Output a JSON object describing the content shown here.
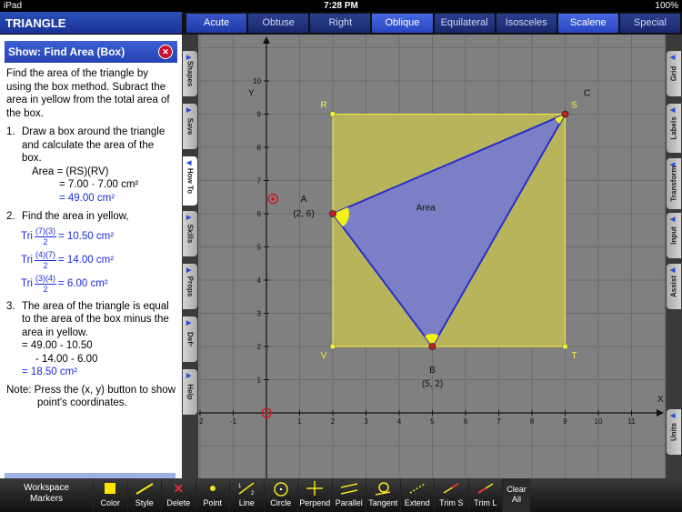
{
  "status": {
    "carrier": "iPad",
    "time": "7:28 PM",
    "battery": "100%"
  },
  "app_title": "TRIANGLE",
  "tabs": [
    {
      "label": "Acute",
      "state": "normal"
    },
    {
      "label": "Obtuse",
      "state": "dim"
    },
    {
      "label": "Right",
      "state": "dim"
    },
    {
      "label": "Oblique",
      "state": "selected"
    },
    {
      "label": "Equilateral",
      "state": "dim"
    },
    {
      "label": "Isosceles",
      "state": "dim"
    },
    {
      "label": "Scalene",
      "state": "selected"
    },
    {
      "label": "Special",
      "state": "dim"
    }
  ],
  "panel": {
    "header": "Show: Find Area (Box)",
    "close_icon": "x-circle-icon",
    "intro": "Find the area of the triangle by using the box method. Subract the area in yellow from the total area of the box.",
    "step1_num": "1.",
    "step1_text": "Draw a box around the triangle and calculate the area of the box.",
    "step1_eq1": "Area = (RS)(RV)",
    "step1_eq2": "= 7.00 · 7.00 cm²",
    "step1_eq3": "= 49.00 cm²",
    "step2_num": "2.",
    "step2_text": "Find the area in yellow,",
    "tri_label": "Tri",
    "tri1": {
      "num": "(7)(3)",
      "den": "2",
      "result": "= 10.50 cm²"
    },
    "tri2": {
      "num": "(4)(7)",
      "den": "2",
      "result": "= 14.00 cm²"
    },
    "tri3": {
      "num": "(3)(4)",
      "den": "2",
      "result": "= 6.00 cm²"
    },
    "step3_num": "3.",
    "step3_text": "The area of the triangle is equal to the area of the box minus the area in yellow.",
    "step3_eq1": "= 49.00 - 10.50",
    "step3_eq2": "- 14.00 - 6.00",
    "step3_eq3": "= 18.50 cm²",
    "note": "Note:  Press the (x, y) button to show point's coordinates."
  },
  "left_tabs": [
    "Shapes",
    "Save",
    "How To",
    "Skills",
    "Props",
    "Defⁿ",
    "Help"
  ],
  "right_tabs": [
    "Grid",
    "Labels",
    "Transform",
    "Input",
    "Assist",
    "Units"
  ],
  "graph": {
    "x_axis_label": "X",
    "y_axis_label": "Y",
    "x_ticks": [
      "-2",
      "-1",
      "1",
      "2",
      "3",
      "4",
      "5",
      "6",
      "7",
      "8",
      "9",
      "10",
      "11"
    ],
    "y_ticks": [
      "1",
      "2",
      "3",
      "4",
      "5",
      "6",
      "7",
      "8",
      "9",
      "10"
    ],
    "triangle_name": "C",
    "area_label": "Area",
    "points": [
      {
        "name": "A",
        "coords": "(2, 6)",
        "x": 2,
        "y": 6
      },
      {
        "name": "B",
        "coords": "(5, 2)",
        "x": 5,
        "y": 2
      },
      {
        "name": "S",
        "x": 9,
        "y": 9
      },
      {
        "name": "R",
        "x": 2,
        "y": 9
      },
      {
        "name": "V",
        "x": 2,
        "y": 2
      },
      {
        "name": "T",
        "x": 9,
        "y": 2
      }
    ],
    "colors": {
      "box_fill": "#b7b45c",
      "triangle_fill": "#7d7fc6",
      "edge": "#2b2fc7",
      "point": "#c41e2a",
      "angle": "#f2f212",
      "box_label": "#f4f236"
    }
  },
  "toolbar": {
    "workspace_line1": "Workspace",
    "workspace_line2": "Markers",
    "items": [
      {
        "label": "Color",
        "icon": "color-square-icon"
      },
      {
        "label": "Style",
        "icon": "style-line-icon"
      },
      {
        "label": "Delete",
        "icon": "delete-x-icon"
      },
      {
        "label": "Point",
        "icon": "point-icon"
      },
      {
        "label": "Line",
        "icon": "line-icon"
      },
      {
        "label": "Circle",
        "icon": "circle-icon"
      },
      {
        "label": "Perpend",
        "icon": "perpendicular-icon"
      },
      {
        "label": "Parallel",
        "icon": "parallel-icon"
      },
      {
        "label": "Tangent",
        "icon": "tangent-icon"
      },
      {
        "label": "Extend",
        "icon": "extend-icon"
      },
      {
        "label": "Trim S",
        "icon": "trim-s-icon"
      },
      {
        "label": "Trim L",
        "icon": "trim-l-icon"
      }
    ],
    "clear_line1": "Clear",
    "clear_line2": "All"
  }
}
